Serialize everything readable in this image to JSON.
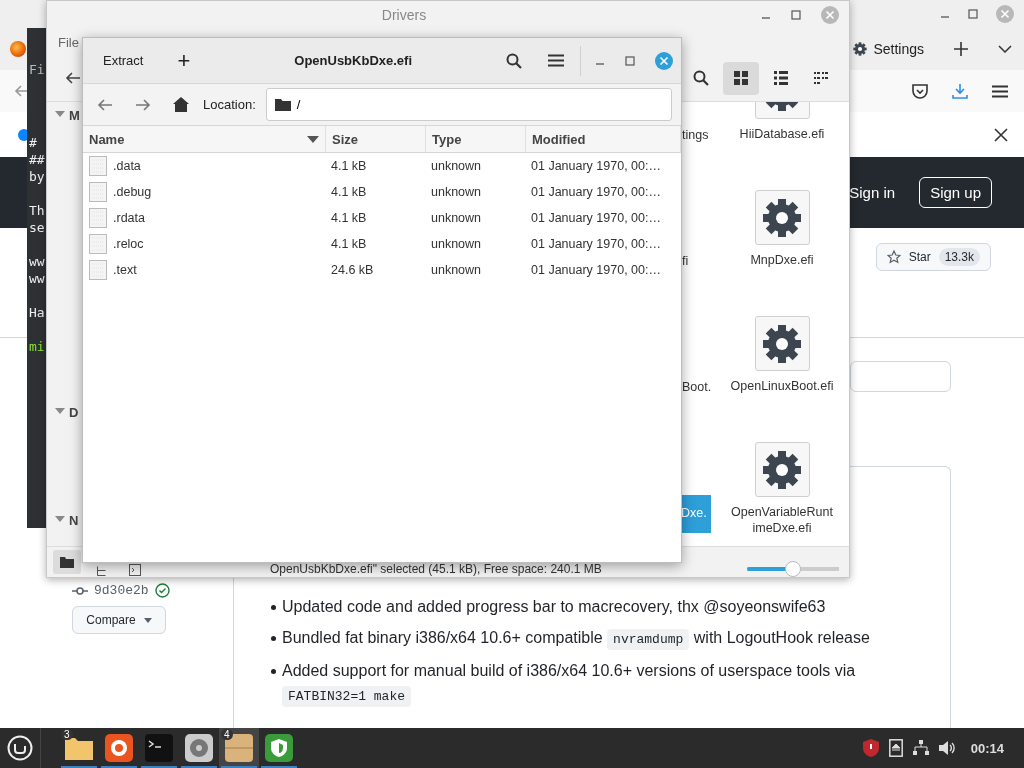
{
  "browser": {
    "tab": {
      "label": "Settings"
    },
    "header_link": "Sign in",
    "signup_button": "Sign up",
    "star_button": {
      "label": "Star",
      "count": "13.3k"
    },
    "commit": "9d30e2b",
    "compare_button": "Compare",
    "release_notes": [
      [
        {
          "kind": "text",
          "text": "Updated code and added progress bar to macrecovery, thx @soyeonswife63"
        }
      ],
      [
        {
          "kind": "text",
          "text": "Bundled fat binary i386/x64 10.6+ compatible "
        },
        {
          "kind": "code",
          "text": "nvramdump"
        },
        {
          "kind": "text",
          "text": " with LogoutHook release"
        }
      ],
      [
        {
          "kind": "text",
          "text": "Added support for manual build of i386/x64 10.6+ versions of userspace tools via "
        },
        {
          "kind": "code",
          "text": "FATBIN32=1 make"
        }
      ]
    ]
  },
  "terminal": {
    "menu": "Fi",
    "paragraphs": [
      [
        "#",
        "##",
        "by"
      ],
      [
        "Th",
        "se"
      ],
      [
        "ww",
        "ww"
      ],
      [
        "Ha"
      ]
    ],
    "prompt": "mi"
  },
  "drivers": {
    "title": "Drivers",
    "menu": [
      "File"
    ],
    "sidebar_sections": [
      {
        "label": "M",
        "expanded": true
      },
      {
        "label": "D",
        "expanded": true
      },
      {
        "label": "N",
        "expanded": true
      }
    ],
    "view_buttons": [
      {
        "kind": "grid",
        "selected": true
      },
      {
        "kind": "list",
        "selected": false
      },
      {
        "kind": "compact",
        "selected": false
      }
    ],
    "partial_items": [
      {
        "label": "tings",
        "selected": false
      },
      {
        "label": "fi",
        "selected": false
      },
      {
        "label": "Boot.",
        "selected": false
      },
      {
        "label": "Dxe.",
        "selected": true
      }
    ],
    "items": [
      {
        "label": "HiiDatabase.efi",
        "selected": false
      },
      {
        "label": "MnpDxe.efi",
        "selected": false
      },
      {
        "label": "OpenLinuxBoot.efi",
        "selected": false
      },
      {
        "label": "OpenVariableRuntimeDxe.efi",
        "selected": false
      }
    ],
    "panel_buttons": [
      {
        "kind": "places",
        "selected": true
      },
      {
        "kind": "tree",
        "selected": false
      },
      {
        "kind": "terminal",
        "selected": false
      }
    ],
    "status": "OpenUsbKbDxe.efi\" selected (45.1 kB), Free space: 240.1 MB",
    "zoom": {
      "level": 0.5
    }
  },
  "archive": {
    "extract_button": "Extract",
    "add_button": "+",
    "title": "OpenUsbKbDxe.efi",
    "location_label": "Location:",
    "path": "/",
    "columns": [
      {
        "label": "Name",
        "sorted": true
      },
      {
        "label": "Size",
        "sorted": false
      },
      {
        "label": "Type",
        "sorted": false
      },
      {
        "label": "Modified",
        "sorted": false
      }
    ],
    "rows": [
      {
        "name": ".data",
        "size": "4.1 kB",
        "type": "unknown",
        "modified": "01 January 1970, 00:…"
      },
      {
        "name": ".debug",
        "size": "4.1 kB",
        "type": "unknown",
        "modified": "01 January 1970, 00:…"
      },
      {
        "name": ".rdata",
        "size": "4.1 kB",
        "type": "unknown",
        "modified": "01 January 1970, 00:…"
      },
      {
        "name": ".reloc",
        "size": "4.1 kB",
        "type": "unknown",
        "modified": "01 January 1970, 00:…"
      },
      {
        "name": ".text",
        "size": "24.6 kB",
        "type": "unknown",
        "modified": "01 January 1970, 00:…"
      }
    ]
  },
  "taskbar": {
    "apps": [
      {
        "kind": "folder",
        "badge": "3",
        "active": false
      },
      {
        "kind": "firefox",
        "active": false
      },
      {
        "kind": "terminal",
        "active": false
      },
      {
        "kind": "disk",
        "active": false
      },
      {
        "kind": "archive",
        "badge": "4",
        "active": true
      },
      {
        "kind": "shield",
        "active": false
      }
    ],
    "clock": "00:14"
  }
}
